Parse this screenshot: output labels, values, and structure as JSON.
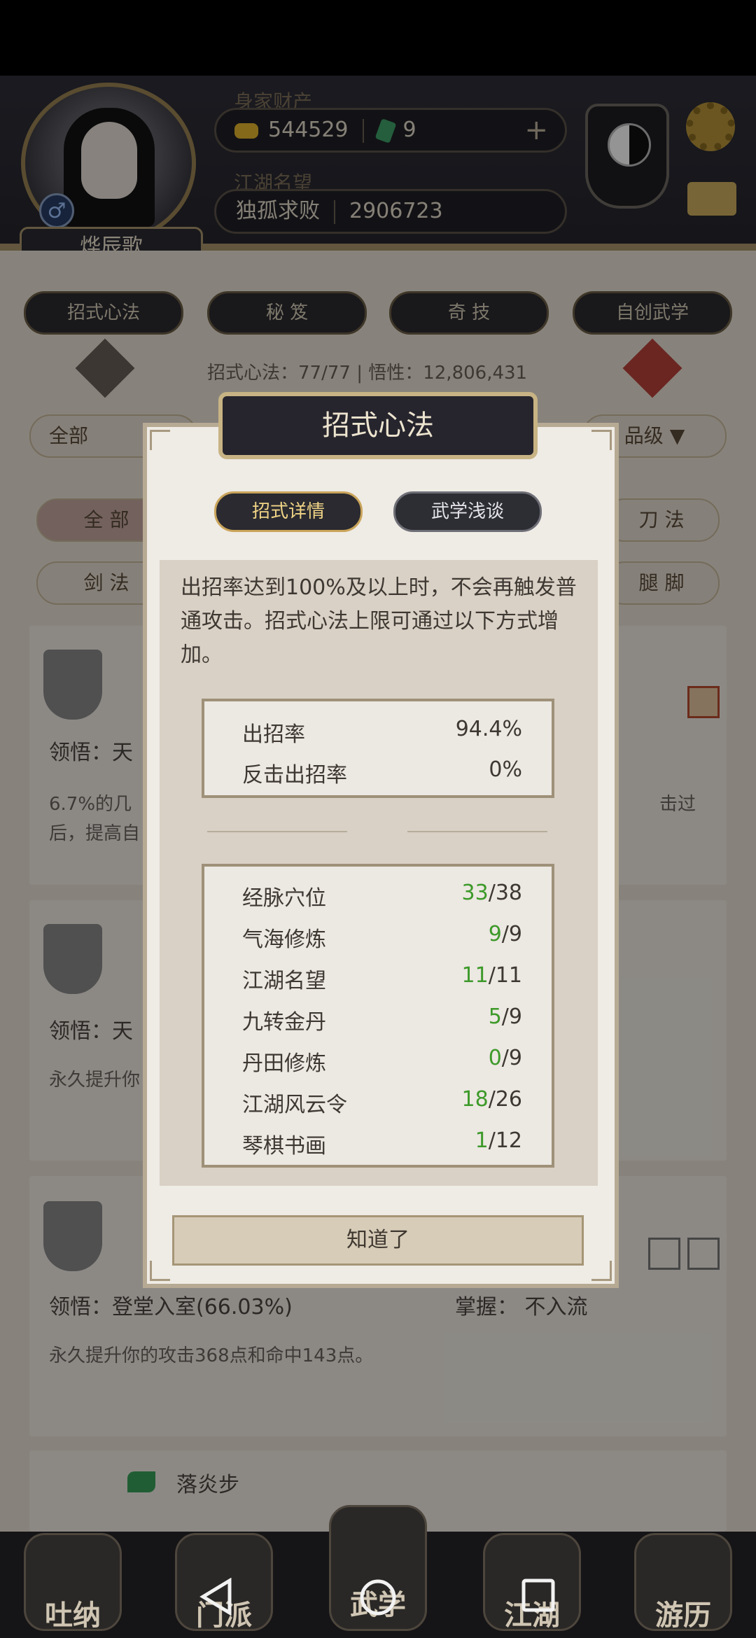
{
  "header": {
    "player_name": "烨辰歌",
    "wealth_label": "身家财产",
    "gold": "544529",
    "jade": "9",
    "add_symbol": "+",
    "fame_label": "江湖名望",
    "fame_title": "独孤求败",
    "fame_value": "2906723",
    "gender_symbol": "♂"
  },
  "tabs": [
    "招式心法",
    "秘 笈",
    "奇 技",
    "自创武学"
  ],
  "summary_line": "招式心法：77/77  |  悟性：12,806,431",
  "filters": {
    "row1_left": "全部",
    "row1_right": "品级",
    "row2_left": "全 部",
    "row2_right": "刀 法",
    "row3_left": "剑 法",
    "row3_right": "腿 脚"
  },
  "cards": [
    {
      "comprehension_label": "领悟：天",
      "desc": "6.7%的几",
      "desc2": "后，提高自",
      "desc_right": "击过"
    },
    {
      "comprehension_label": "领悟：天",
      "desc": "永久提升你"
    },
    {
      "comprehension_label": "领悟：登堂入室(66.03%)",
      "mastery_label": "掌握：  不入流",
      "desc": "永久提升你的攻击368点和命中143点。"
    },
    {
      "title": "落炎步"
    }
  ],
  "dialog": {
    "title": "招式心法",
    "tab_active": "招式详情",
    "tab_inactive": "武学浅谈",
    "description": "出招率达到100%及以上时，不会再触发普通攻击。招式心法上限可通过以下方式增加。",
    "rates": [
      {
        "label": "出招率",
        "value": "94.4%"
      },
      {
        "label": "反击出招率",
        "value": "0%"
      }
    ],
    "sources": [
      {
        "label": "经脉穴位",
        "current": "33",
        "max": "/38"
      },
      {
        "label": "气海修炼",
        "current": "9",
        "max": "/9"
      },
      {
        "label": "江湖名望",
        "current": "11",
        "max": "/11"
      },
      {
        "label": "九转金丹",
        "current": "5",
        "max": "/9"
      },
      {
        "label": "丹田修炼",
        "current": "0",
        "max": "/9"
      },
      {
        "label": "江湖风云令",
        "current": "18",
        "max": "/26"
      },
      {
        "label": "琴棋书画",
        "current": "1",
        "max": "/12"
      }
    ],
    "ok_button": "知道了"
  },
  "bottom_nav": [
    "吐纳",
    "门派",
    "武学",
    "江湖",
    "游历"
  ],
  "colors": {
    "accent_gold": "#caa45a",
    "progress_green": "#3d9a2a",
    "dark_panel": "#26252d"
  }
}
